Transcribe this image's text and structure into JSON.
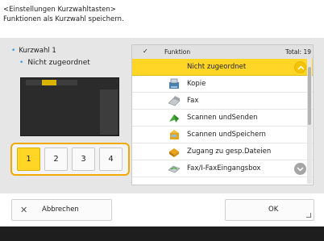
{
  "header": {
    "line1": "<Einstellungen Kurzwahltasten>",
    "line2": "Funktionen als Kurzwahl speichern."
  },
  "left": {
    "kurzwahl_label": "Kurzwahl 1",
    "assignment": "Nicht zugeordnet",
    "keys": [
      "1",
      "2",
      "3",
      "4"
    ],
    "selected_key": "1"
  },
  "list": {
    "header_check": "✓",
    "header_function": "Funktion",
    "header_total": "Total:  19",
    "items": [
      {
        "label": "Nicht zugeordnet",
        "icon": "none",
        "selected": true
      },
      {
        "label": "Kopie",
        "icon": "copy-icon",
        "selected": false
      },
      {
        "label": "Fax",
        "icon": "fax-icon",
        "selected": false
      },
      {
        "label": "Scannen undSenden",
        "icon": "scan-send-icon",
        "selected": false
      },
      {
        "label": "Scannen undSpeichern",
        "icon": "scan-store-icon",
        "selected": false
      },
      {
        "label": "Zugang zu gesp.Dateien",
        "icon": "stored-files-icon",
        "selected": false
      },
      {
        "label": "Fax/I-FaxEingangsbox",
        "icon": "fax-inbox-icon",
        "selected": false
      }
    ]
  },
  "buttons": {
    "cancel": "Abbrechen",
    "ok": "OK"
  },
  "colors": {
    "highlight": "#ffd626",
    "focus_border": "#f2a900",
    "bullet": "#3a9bd9",
    "footer": "#1e1e1e"
  }
}
